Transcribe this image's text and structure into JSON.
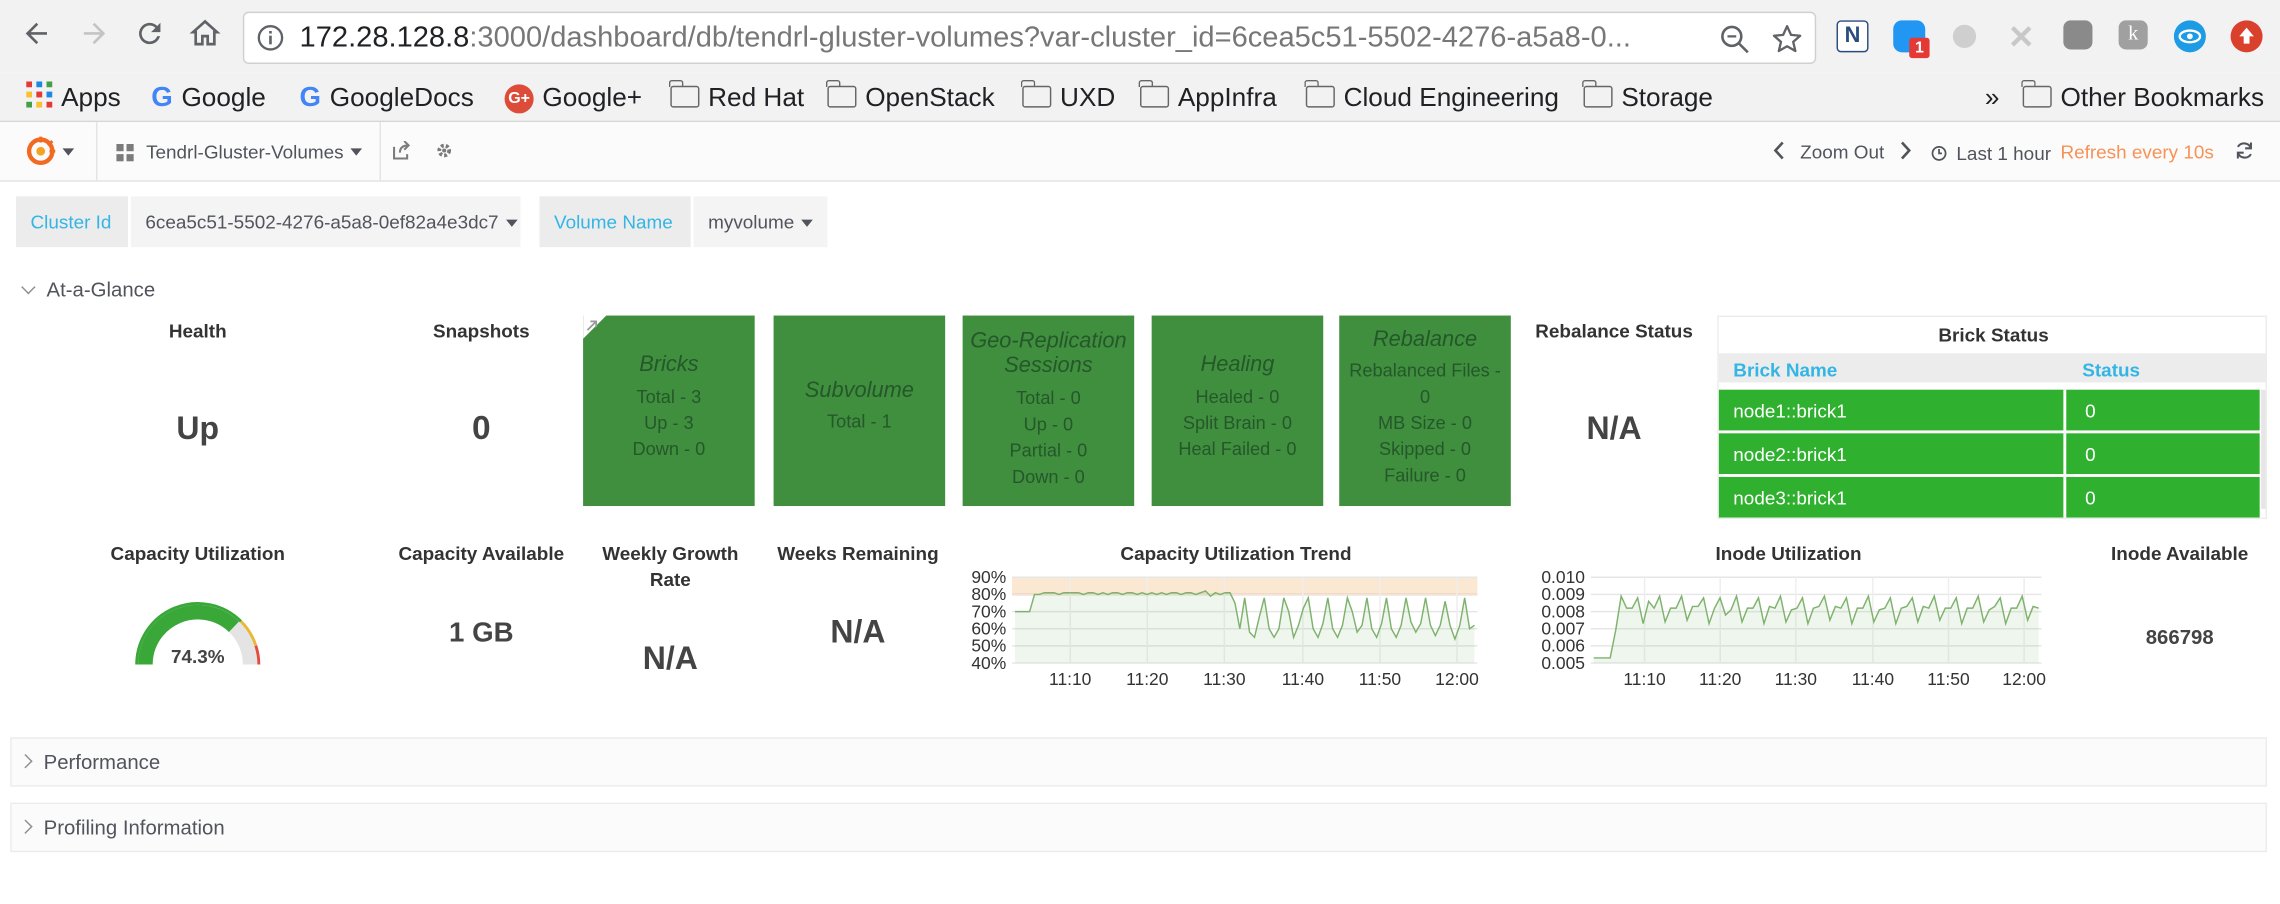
{
  "browser": {
    "url_host": "172.28.128.8",
    "url_rest": ":3000/dashboard/db/tendrl-gluster-volumes?var-cluster_id=6cea5c51-5502-4276-a5a8-0...",
    "ext_badge": "1",
    "bookmarks": [
      "Apps",
      "Google",
      "GoogleDocs",
      "Google+",
      "Red Hat",
      "OpenStack",
      "UXD",
      "AppInfra",
      "Cloud Engineering",
      "Storage"
    ],
    "more": "»",
    "other_bookmarks": "Other Bookmarks"
  },
  "grafana": {
    "dashboard_title": "Tendrl-Gluster-Volumes",
    "zoom_out": "Zoom Out",
    "time_range": "Last 1 hour",
    "refresh": "Refresh every 10s",
    "refresh_color": "#f79256"
  },
  "variables": [
    {
      "label": "Cluster Id",
      "value": "6cea5c51-5502-4276-a5a8-0ef82a4e3dc7"
    },
    {
      "label": "Volume Name",
      "value": "myvolume"
    }
  ],
  "rows": {
    "at_a_glance": "At-a-Glance",
    "performance": "Performance",
    "profiling": "Profiling Information"
  },
  "panels": {
    "health": {
      "title": "Health",
      "value": "Up"
    },
    "snapshots": {
      "title": "Snapshots",
      "value": "0"
    },
    "bricks": {
      "title": "Bricks",
      "lines": [
        "Total - 3",
        "Up - 3",
        "Down - 0"
      ]
    },
    "subvolume": {
      "title": "Subvolume",
      "lines": [
        "Total - 1"
      ]
    },
    "georep": {
      "title_1": "Geo-Replication",
      "title_2": "Sessions",
      "lines": [
        "Total - 0",
        "Up - 0",
        "Partial - 0",
        "Down - 0"
      ]
    },
    "healing": {
      "title": "Healing",
      "lines": [
        "Healed - 0",
        "Split Brain - 0",
        "Heal Failed - 0"
      ]
    },
    "rebalance": {
      "title": "Rebalance",
      "lines": [
        "Rebalanced Files -",
        "0",
        "MB Size - 0",
        "Skipped - 0",
        "Failure - 0"
      ]
    },
    "rebalance_status": {
      "title": "Rebalance Status",
      "value": "N/A"
    },
    "brick_status": {
      "title": "Brick Status",
      "col_name": "Brick Name",
      "col_status": "Status",
      "rows": [
        {
          "name": "node1::brick1",
          "status": "0"
        },
        {
          "name": "node2::brick1",
          "status": "0"
        },
        {
          "name": "node3::brick1",
          "status": "0"
        }
      ],
      "ok_color": "#2fb12f"
    },
    "capacity_utilization": {
      "title": "Capacity Utilization",
      "value": "74.3%",
      "percent": 74.3
    },
    "capacity_available": {
      "title": "Capacity Available",
      "value": "1 GB"
    },
    "weekly_growth": {
      "title_1": "Weekly Growth",
      "title_2": "Rate",
      "value": "N/A"
    },
    "weeks_remaining": {
      "title": "Weeks Remaining",
      "value": "N/A"
    },
    "inode_available": {
      "title": "Inode Available",
      "value": "866798"
    }
  },
  "chart_data": [
    {
      "type": "line",
      "title": "Capacity Utilization Trend",
      "y_ticks": [
        "90%",
        "80%",
        "70%",
        "60%",
        "50%",
        "40%"
      ],
      "x_ticks": [
        "11:10",
        "11:20",
        "11:30",
        "11:40",
        "11:50",
        "12:00"
      ],
      "ylim": [
        40,
        90
      ],
      "threshold": 80,
      "values": [
        70,
        70,
        70,
        70,
        80,
        80,
        81,
        81,
        81,
        80,
        81,
        81,
        81,
        81,
        80,
        81,
        81,
        80,
        81,
        80,
        81,
        81,
        80,
        81,
        81,
        80,
        81,
        80,
        81,
        80,
        81,
        80,
        81,
        81,
        80,
        81,
        81,
        80,
        81,
        82,
        79,
        81,
        80,
        81,
        81,
        75,
        60,
        78,
        58,
        55,
        67,
        78,
        60,
        55,
        60,
        78,
        70,
        55,
        62,
        72,
        78,
        60,
        55,
        63,
        78,
        60,
        55,
        62,
        78,
        70,
        58,
        62,
        78,
        60,
        55,
        63,
        78,
        60,
        55,
        62,
        78,
        64,
        58,
        63,
        78,
        62,
        56,
        62,
        76,
        62,
        54,
        62,
        78,
        60,
        62
      ],
      "color": "#7eb26d"
    },
    {
      "type": "line",
      "title": "Inode Utilization",
      "y_ticks": [
        "0.010",
        "0.009",
        "0.008",
        "0.007",
        "0.006",
        "0.005"
      ],
      "x_ticks": [
        "11:10",
        "11:20",
        "11:30",
        "11:40",
        "11:50",
        "12:00"
      ],
      "ylim": [
        0.005,
        0.01
      ],
      "values": [
        0.0053,
        0.0053,
        0.0053,
        0.0053,
        0.0069,
        0.0089,
        0.0082,
        0.0082,
        0.0088,
        0.0073,
        0.0086,
        0.0082,
        0.0089,
        0.0074,
        0.0082,
        0.0082,
        0.0089,
        0.0075,
        0.0083,
        0.0083,
        0.0088,
        0.0073,
        0.0082,
        0.0088,
        0.0078,
        0.0081,
        0.0089,
        0.0074,
        0.0082,
        0.0082,
        0.0088,
        0.0073,
        0.0083,
        0.0082,
        0.0089,
        0.0074,
        0.0081,
        0.0082,
        0.0088,
        0.0073,
        0.0082,
        0.0083,
        0.0089,
        0.0075,
        0.0083,
        0.0082,
        0.0088,
        0.0073,
        0.0082,
        0.0082,
        0.0089,
        0.0074,
        0.0081,
        0.0082,
        0.0088,
        0.0073,
        0.0082,
        0.0083,
        0.0088,
        0.0074,
        0.0083,
        0.0082,
        0.0089,
        0.0075,
        0.0082,
        0.0082,
        0.0088,
        0.0073,
        0.0082,
        0.0082,
        0.0089,
        0.0074,
        0.0081,
        0.0083,
        0.0088,
        0.0073,
        0.0082,
        0.0082,
        0.0089,
        0.0075,
        0.0083,
        0.0082
      ],
      "color": "#7eb26d"
    }
  ]
}
